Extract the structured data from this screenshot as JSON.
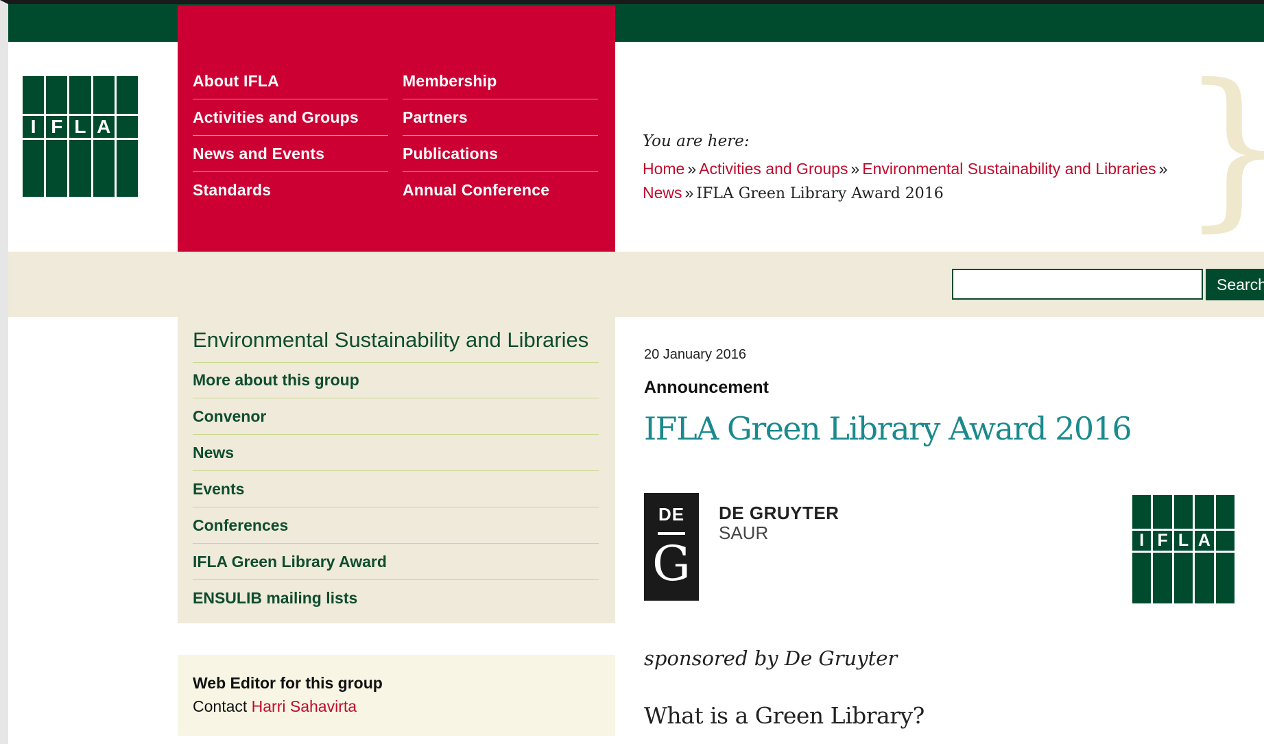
{
  "logo": {
    "letters": [
      "I",
      "F",
      "L",
      "A"
    ]
  },
  "nav": {
    "col1": [
      "About IFLA",
      "Activities and Groups",
      "News and Events",
      "Standards"
    ],
    "col2": [
      "Membership",
      "Partners",
      "Publications",
      "Annual Conference"
    ]
  },
  "breadcrumb": {
    "label": "You are here:",
    "links": [
      "Home",
      "Activities and Groups",
      "Environmental Sustainability and Libraries",
      "News"
    ],
    "separator": "»",
    "current": "IFLA Green Library Award 2016"
  },
  "search": {
    "placeholder": "",
    "button_label": "Search"
  },
  "sidebar": {
    "title": "Environmental Sustainability and Libraries",
    "items": [
      "More about this group",
      "Convenor",
      "News",
      "Events",
      "Conferences",
      "IFLA Green Library Award",
      "ENSULIB mailing lists"
    ]
  },
  "editor": {
    "heading": "Web Editor for this group",
    "contact_prefix": "Contact",
    "contact_name": "Harri Sahavirta"
  },
  "article": {
    "date": "20 January 2016",
    "type": "Announcement",
    "title": "IFLA Green Library Award 2016",
    "sponsor_logo": {
      "top": "DE",
      "letter": "G",
      "name": "DE GRUYTER",
      "sub": "SAUR"
    },
    "sponsored_by": "sponsored by De Gruyter",
    "section_heading": "What is a Green Library?"
  },
  "colors": {
    "dark_green": "#004b2e",
    "red": "#cc0033",
    "beige": "#efeada",
    "link_red": "#c00a2c",
    "teal": "#1b8a8e"
  }
}
